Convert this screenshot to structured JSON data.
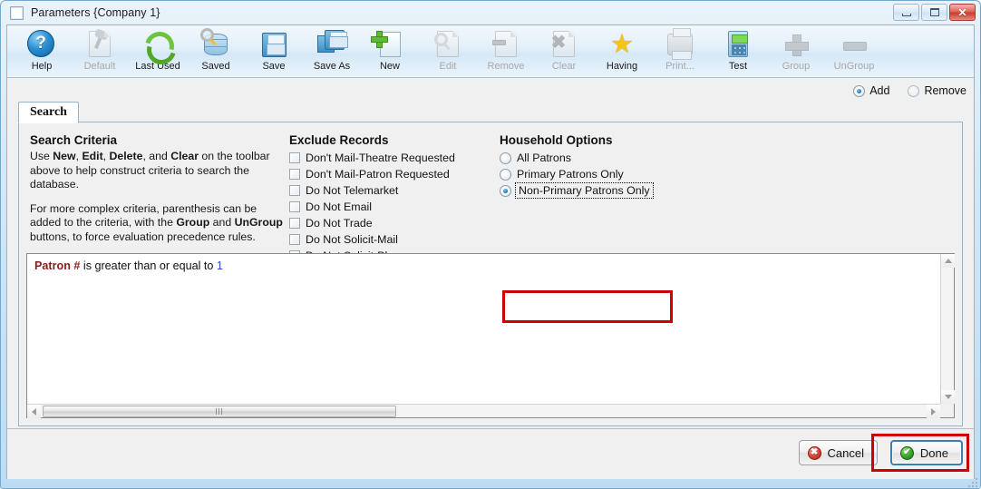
{
  "window": {
    "title": "Parameters {Company 1}",
    "icon": "window-icon",
    "controls": {
      "minimize": "minimize-button",
      "maximize": "maximize-button",
      "close_glyph": "✕"
    }
  },
  "toolbar": {
    "items": [
      {
        "label": "Help",
        "icon": "help-icon",
        "enabled": true
      },
      {
        "label": "Default",
        "icon": "pin-page-icon",
        "enabled": false
      },
      {
        "label": "Last Used",
        "icon": "refresh-icon",
        "enabled": true
      },
      {
        "label": "Saved",
        "icon": "database-search-icon",
        "enabled": true
      },
      {
        "label": "Save",
        "icon": "floppy-icon",
        "enabled": true
      },
      {
        "label": "Save As",
        "icon": "floppy-copy-icon",
        "enabled": true
      },
      {
        "label": "New",
        "icon": "new-page-icon",
        "enabled": true
      },
      {
        "label": "Edit",
        "icon": "edit-magnifier-icon",
        "enabled": false
      },
      {
        "label": "Remove",
        "icon": "remove-page-icon",
        "enabled": false
      },
      {
        "label": "Clear",
        "icon": "clear-page-icon",
        "enabled": false
      },
      {
        "label": "Having",
        "icon": "star-icon",
        "enabled": true
      },
      {
        "label": "Print...",
        "icon": "printer-icon",
        "enabled": false
      },
      {
        "label": "Test",
        "icon": "calculator-icon",
        "enabled": true
      },
      {
        "label": "Group",
        "icon": "plus-icon",
        "enabled": false
      },
      {
        "label": "UnGroup",
        "icon": "minus-icon",
        "enabled": false
      }
    ]
  },
  "mode": {
    "add_label": "Add",
    "remove_label": "Remove",
    "selected": "Add"
  },
  "tabs": [
    {
      "label": "Search",
      "active": true
    }
  ],
  "search_criteria": {
    "title": "Search Criteria",
    "paragraph1_parts": [
      {
        "text": "Use ",
        "bold": false
      },
      {
        "text": "New",
        "bold": true
      },
      {
        "text": ", ",
        "bold": false
      },
      {
        "text": "Edit",
        "bold": true
      },
      {
        "text": ", ",
        "bold": false
      },
      {
        "text": "Delete",
        "bold": true
      },
      {
        "text": ", and ",
        "bold": false
      },
      {
        "text": "Clear",
        "bold": true
      },
      {
        "text": " on the toolbar above to help construct criteria to search the database.",
        "bold": false
      }
    ],
    "paragraph2_parts": [
      {
        "text": "For more complex criteria, parenthesis can be added to the criteria, with the ",
        "bold": false
      },
      {
        "text": "Group",
        "bold": true
      },
      {
        "text": " and ",
        "bold": false
      },
      {
        "text": "UnGroup",
        "bold": true
      },
      {
        "text": " buttons, to force evaluation precedence rules.",
        "bold": false
      }
    ]
  },
  "exclude_records": {
    "title": "Exclude Records",
    "items": [
      {
        "label": "Don't Mail-Theatre Requested",
        "checked": false
      },
      {
        "label": "Don't Mail-Patron Requested",
        "checked": false
      },
      {
        "label": "Do Not Telemarket",
        "checked": false
      },
      {
        "label": "Do Not Email",
        "checked": false
      },
      {
        "label": "Do Not Trade",
        "checked": false
      },
      {
        "label": "Do Not Solicit-Mail",
        "checked": false
      },
      {
        "label": "Do Not Solicit-Phone",
        "checked": false
      }
    ]
  },
  "household_options": {
    "title": "Household Options",
    "items": [
      {
        "label": "All Patrons",
        "selected": false,
        "focused": false
      },
      {
        "label": "Primary Patrons Only",
        "selected": false,
        "focused": false
      },
      {
        "label": "Non-Primary Patrons Only",
        "selected": true,
        "focused": true
      }
    ]
  },
  "criteria_list": {
    "rows": [
      {
        "field": "Patron #",
        "operator": "is greater than or equal to",
        "value": "1"
      }
    ]
  },
  "buttons": {
    "cancel": {
      "label": "Cancel",
      "icon": "red-x-circle-icon"
    },
    "done": {
      "label": "Done",
      "icon": "green-check-circle-icon",
      "focused": true
    }
  },
  "annotations": {
    "highlight_color": "#cc0000",
    "boxes": [
      {
        "target": "non-primary-patrons-only-radio"
      },
      {
        "target": "done-button"
      }
    ]
  }
}
